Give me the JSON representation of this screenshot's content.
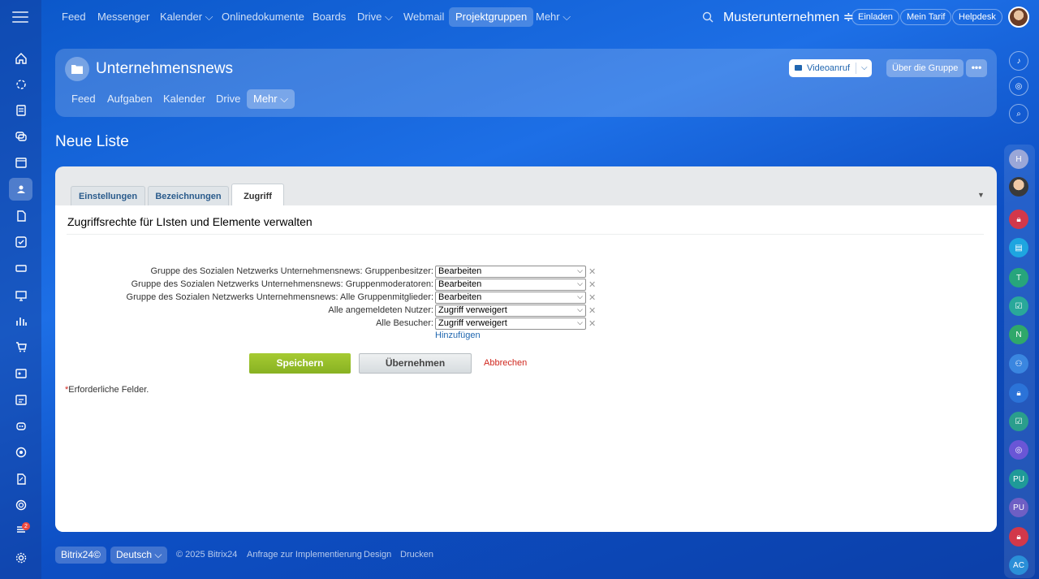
{
  "topnav": {
    "items": [
      {
        "label": "Feed"
      },
      {
        "label": "Messenger"
      },
      {
        "label": "Kalender ⌵"
      },
      {
        "label": "Onlinedokumente"
      },
      {
        "label": "Boards"
      },
      {
        "label": "Drive ⌵"
      },
      {
        "label": "Webmail"
      },
      {
        "label": "Projektgruppen"
      },
      {
        "label": "Mehr ⌵"
      }
    ],
    "company": "Musterunternehmen ≑",
    "invite": "Einladen",
    "plan": "Mein Tarif",
    "helpdesk": "Helpdesk"
  },
  "group": {
    "title": "Unternehmensnews",
    "tabs": [
      "Feed",
      "Aufgaben",
      "Kalender",
      "Drive",
      "Mehr ⌵"
    ],
    "video_label": "Videoanruf",
    "about_label": "Über die Gruppe",
    "more_label": "•••"
  },
  "page_title": "Neue Liste",
  "form": {
    "tabs": [
      "Einstellungen",
      "Bezeichnungen",
      "Zugriff"
    ],
    "section_title": "Zugriffsrechte für LIsten und Elemente verwalten",
    "rows": [
      {
        "label": "Gruppe des Sozialen Netzwerks Unternehmensnews: Gruppenbesitzer:",
        "value": "Bearbeiten"
      },
      {
        "label": "Gruppe des Sozialen Netzwerks Unternehmensnews: Gruppenmoderatoren:",
        "value": "Bearbeiten"
      },
      {
        "label": "Gruppe des Sozialen Netzwerks Unternehmensnews: Alle Gruppenmitglieder:",
        "value": "Bearbeiten"
      },
      {
        "label": "Alle angemeldeten Nutzer:",
        "value": "Zugriff verweigert"
      },
      {
        "label": "Alle Besucher:",
        "value": "Zugriff verweigert"
      }
    ],
    "add_label": "Hinzufügen",
    "save_label": "Speichern",
    "apply_label": "Übernehmen",
    "cancel_label": "Abbrechen",
    "required_star": "*",
    "required_note": "Erforderliche Felder."
  },
  "rightbar": {
    "items": [
      "H",
      "T",
      "N",
      "PU",
      "PU",
      "AC"
    ]
  },
  "sidebar": {
    "badge": "2"
  },
  "footer": {
    "brand": "Bitrix24©",
    "language": "Deutsch ⌵",
    "copyright": "© 2025 Bitrix24",
    "impl": "Anfrage zur Implementierung",
    "design": "Design",
    "print": "Drucken"
  },
  "colors": {
    "save_green": "#88b222",
    "cancel_red": "#d0271e",
    "link_blue": "#2067b0"
  }
}
